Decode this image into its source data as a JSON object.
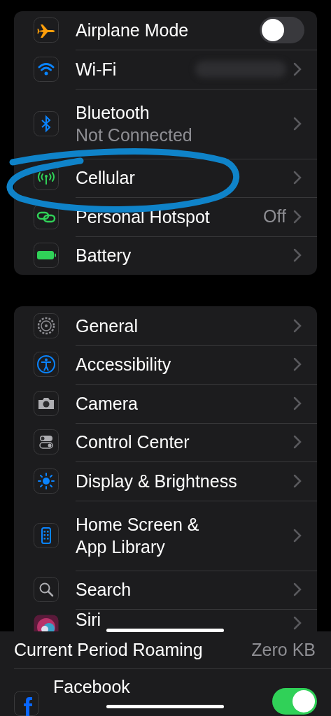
{
  "groups": [
    {
      "items": [
        {
          "label": "Airplane Mode",
          "kind": "toggle",
          "on": false
        },
        {
          "label": "Wi-Fi",
          "kind": "blurred"
        },
        {
          "label": "Bluetooth",
          "subtitle": "Not Connected",
          "kind": "link"
        },
        {
          "label": "Cellular",
          "kind": "link"
        },
        {
          "label": "Personal Hotspot",
          "value": "Off",
          "kind": "link"
        },
        {
          "label": "Battery",
          "kind": "link"
        }
      ]
    },
    {
      "items": [
        {
          "label": "General",
          "kind": "link"
        },
        {
          "label": "Accessibility",
          "kind": "link"
        },
        {
          "label": "Camera",
          "kind": "link"
        },
        {
          "label": "Control Center",
          "kind": "link"
        },
        {
          "label": "Display & Brightness",
          "kind": "link"
        },
        {
          "label": "Home Screen &\nApp Library",
          "kind": "link"
        },
        {
          "label": "Search",
          "kind": "link"
        },
        {
          "label": "Siri",
          "kind": "link"
        }
      ]
    }
  ],
  "cellular_panel": {
    "roaming": {
      "label": "Current Period Roaming",
      "value": "Zero KB"
    },
    "apps": [
      {
        "label": "Facebook",
        "on": true
      }
    ]
  }
}
